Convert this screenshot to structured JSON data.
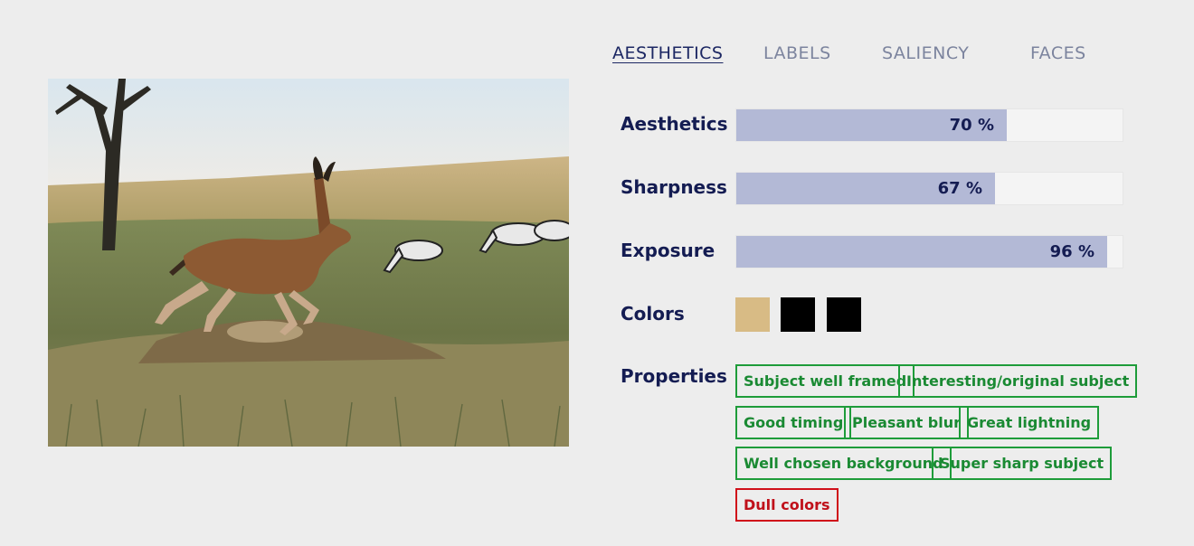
{
  "tabs": [
    {
      "label": "AESTHETICS",
      "active": true
    },
    {
      "label": "LABELS",
      "active": false
    },
    {
      "label": "SALIENCY",
      "active": false
    },
    {
      "label": "FACES",
      "active": false
    }
  ],
  "metrics": [
    {
      "label": "Aesthetics",
      "value": 0.7,
      "display": "70 %"
    },
    {
      "label": "Sharpness",
      "value": 0.67,
      "display": "67 %"
    },
    {
      "label": "Exposure",
      "value": 0.96,
      "display": "96 %"
    }
  ],
  "colors": {
    "label": "Colors",
    "swatches": [
      "#d8bb85",
      "#000000",
      "#000000"
    ]
  },
  "properties": {
    "label": "Properties",
    "positive": [
      "Subject well framed",
      "Interesting/original subject",
      "Good timing",
      "Pleasant blur",
      "Great lightning",
      "Well chosen background",
      "Super sharp subject"
    ],
    "negative": [
      "Dull colors"
    ]
  },
  "theme": {
    "positive_color": "#1e9c3a",
    "negative_color": "#d0101a",
    "bar_fill": "#b3b9d6",
    "text_dark": "#141c52"
  }
}
